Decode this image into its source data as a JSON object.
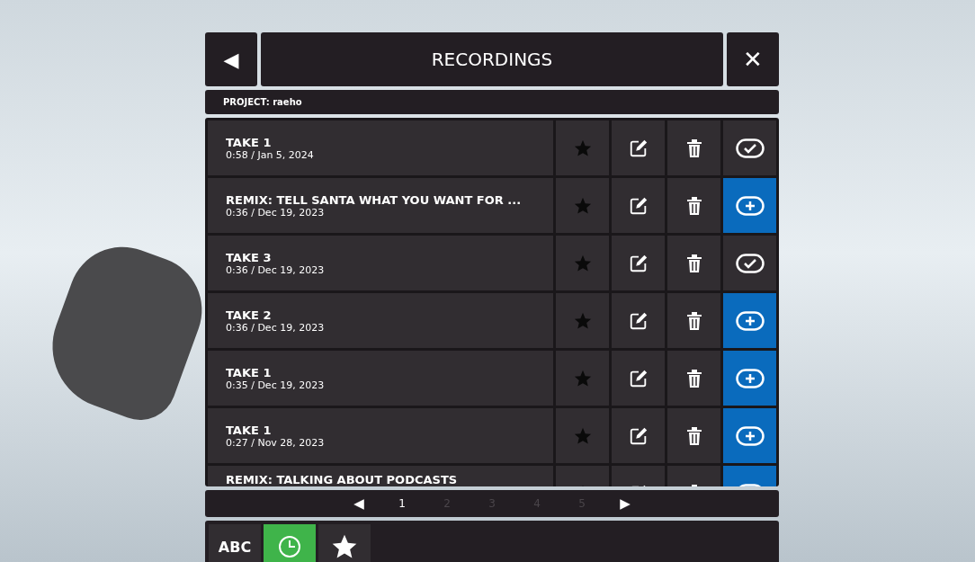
{
  "header": {
    "back": "◀",
    "title": "RECORDINGS",
    "close": "✕"
  },
  "project": "PROJECT: raeho",
  "recordings": [
    {
      "title": "TAKE 1",
      "meta": "0:58 / Jan 5, 2024",
      "kind": "check"
    },
    {
      "title": "REMIX: TELL SANTA WHAT YOU WANT FOR ...",
      "meta": "0:36 / Dec 19, 2023",
      "kind": "add"
    },
    {
      "title": "TAKE 3",
      "meta": "0:36 / Dec 19, 2023",
      "kind": "check"
    },
    {
      "title": "TAKE 2",
      "meta": "0:36 / Dec 19, 2023",
      "kind": "add"
    },
    {
      "title": "TAKE 1",
      "meta": "0:35 / Dec 19, 2023",
      "kind": "add"
    },
    {
      "title": "TAKE 1",
      "meta": "0:27 / Nov 28, 2023",
      "kind": "add"
    },
    {
      "title": "REMIX: TALKING ABOUT PODCASTS",
      "kind": "add"
    }
  ],
  "pagination": {
    "prev": "◀",
    "next": "▶",
    "pages": [
      {
        "label": "1",
        "selected": true
      },
      {
        "label": "2",
        "selected": false
      },
      {
        "label": "3",
        "selected": false
      },
      {
        "label": "4",
        "selected": false
      },
      {
        "label": "5",
        "selected": false
      }
    ]
  },
  "sort_tabs": [
    {
      "kind": "text",
      "label": "ABC",
      "selected": false
    },
    {
      "kind": "clock",
      "selected": true
    },
    {
      "kind": "star",
      "selected": false
    }
  ]
}
